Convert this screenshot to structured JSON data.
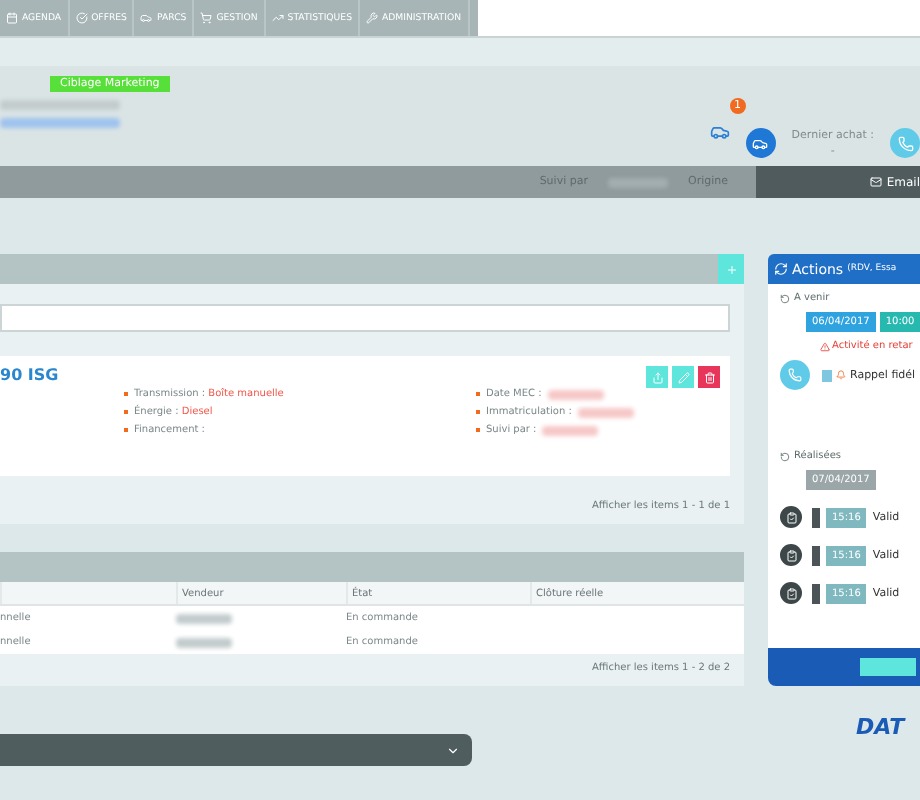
{
  "nav": {
    "items": [
      "AGENDA",
      "OFFRES",
      "PARCS",
      "GESTION",
      "STATISTIQUES",
      "ADMINISTRATION"
    ]
  },
  "header": {
    "tag": "Ciblage Marketing",
    "vehicle_count": "1",
    "last_purchase_label": "Dernier achat :",
    "last_purchase_value": "-"
  },
  "info_bar": {
    "followed_by": "Suivi par",
    "origin": "Origine",
    "email": "Email"
  },
  "vehicles": {
    "title": "90 ISG",
    "details_left": [
      {
        "label": "Transmission :",
        "value": "Boîte manuelle"
      },
      {
        "label": "Énergie :",
        "value": "Diesel"
      },
      {
        "label": "Financement :"
      }
    ],
    "details_right": [
      {
        "label": "Date MEC :"
      },
      {
        "label": "Immatriculation :"
      },
      {
        "label": "Suivi par :"
      }
    ],
    "pager": "Afficher les items 1 - 1 de 1"
  },
  "orders": {
    "columns": [
      "Vendeur",
      "État",
      "Clôture réelle"
    ],
    "rows": [
      {
        "column_1": "nnelle",
        "state": "En commande"
      },
      {
        "column_1": "nnelle",
        "state": "En commande"
      }
    ],
    "pager": "Afficher les items 1 - 2 de 2"
  },
  "actions": {
    "title": "Actions",
    "subtitle": "(RDV, Essa",
    "upcoming": {
      "heading": "A venir",
      "date": "06/04/2017",
      "time": "10:00",
      "alert": "Activité en retar",
      "item": "Rappel fidél"
    },
    "done": {
      "heading": "Réalisées",
      "date": "07/04/2017",
      "items": [
        {
          "time": "15:16",
          "text": "Valid"
        },
        {
          "time": "15:16",
          "text": "Valid"
        },
        {
          "time": "15:16",
          "text": "Valid"
        }
      ]
    }
  },
  "logo": "DAT"
}
